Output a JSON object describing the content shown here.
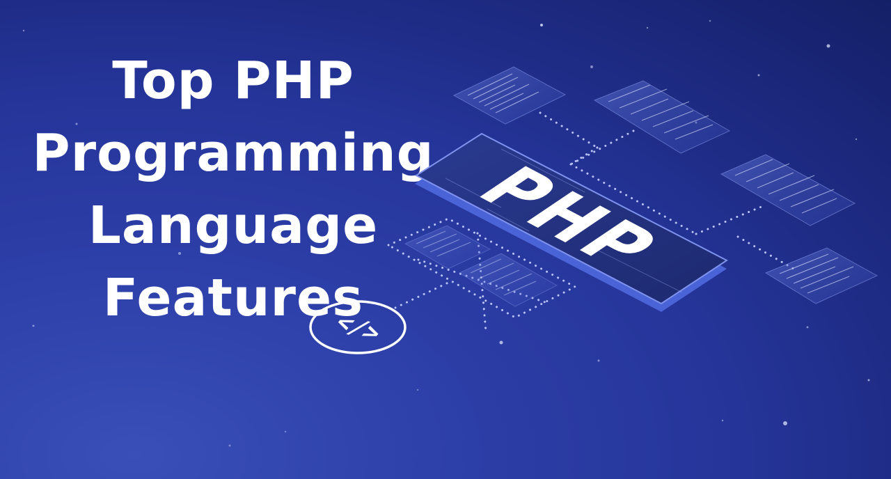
{
  "title": {
    "lines": [
      "Top PHP",
      "Programming",
      "Language",
      "Features"
    ]
  },
  "platform": {
    "label": "PHP",
    "color": "#ffffff"
  },
  "code_icon": {
    "icon": "code-brackets-icon",
    "glyph": "</>"
  },
  "colors": {
    "background_top": "#142066",
    "background_bottom": "#3a4fb8",
    "platform_face": "#23327e",
    "platform_edge": "#4a63d6",
    "dots": "#c9d3ff"
  }
}
